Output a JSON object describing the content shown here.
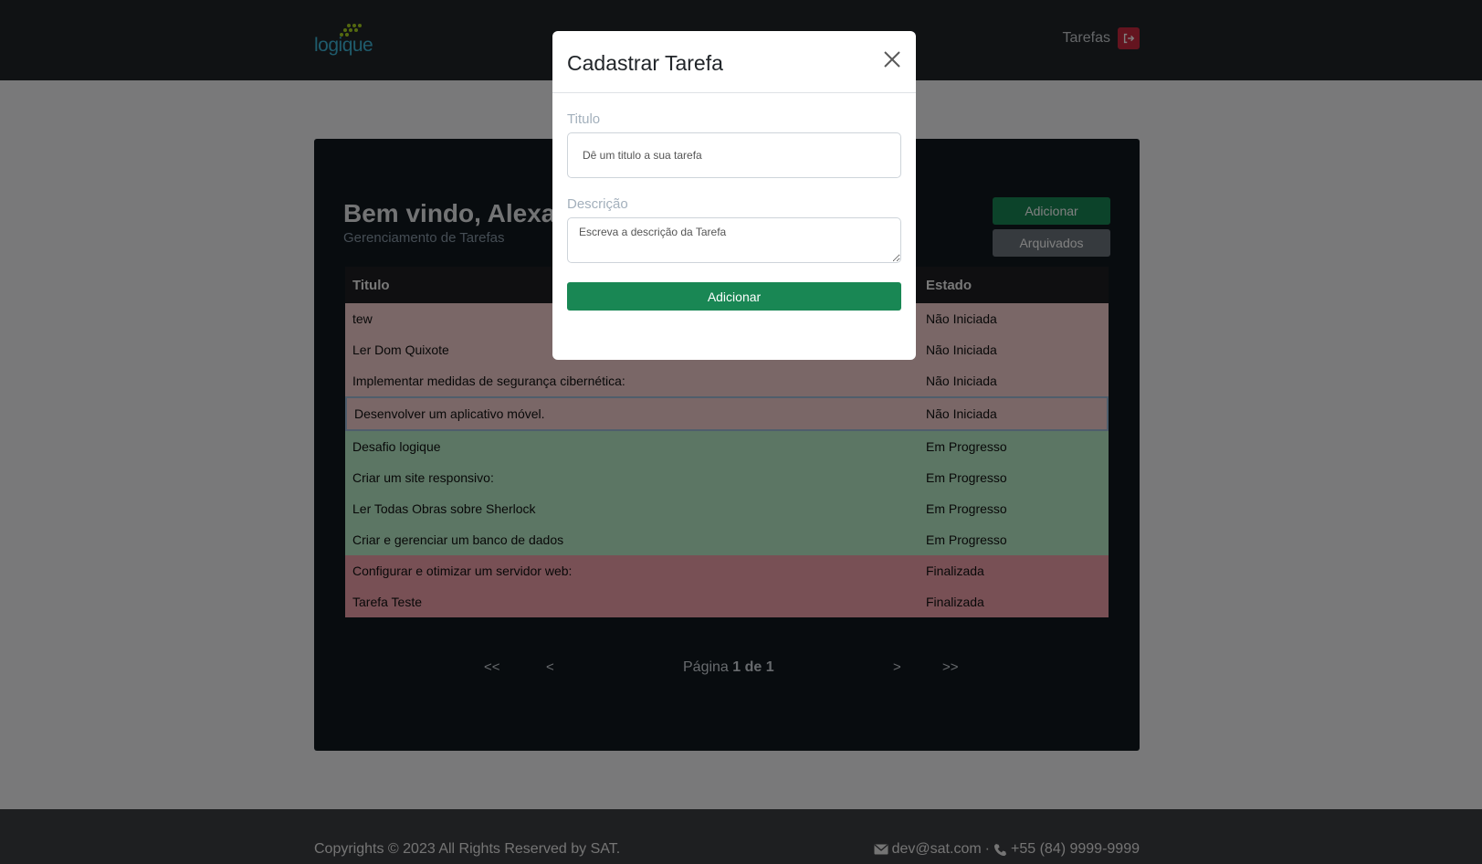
{
  "navbar": {
    "logo_text": "logique",
    "nav_link": "Tarefas"
  },
  "main": {
    "welcome": "Bem vindo, Alexa",
    "subtitle": "Gerenciamento de Tarefas",
    "add_button": "Adicionar",
    "archived_button": "Arquivados",
    "table": {
      "headers": [
        "Titulo",
        "Estado"
      ],
      "rows": [
        {
          "title": "tew",
          "state": "Não Iniciada"
        },
        {
          "title": "Ler Dom Quixote",
          "state": "Não Iniciada"
        },
        {
          "title": "Implementar medidas de segurança cibernética:",
          "state": "Não Iniciada"
        },
        {
          "title": "Desenvolver um aplicativo móvel.",
          "state": "Não Iniciada"
        },
        {
          "title": "Desafio logique",
          "state": "Em Progresso"
        },
        {
          "title": "Criar um site responsivo:",
          "state": "Em Progresso"
        },
        {
          "title": "Ler Todas Obras sobre Sherlock",
          "state": "Em Progresso"
        },
        {
          "title": "Criar e gerenciar um banco de dados",
          "state": "Em Progresso"
        },
        {
          "title": "Configurar e otimizar um servidor web:",
          "state": "Finalizada"
        },
        {
          "title": "Tarefa Teste",
          "state": "Finalizada"
        }
      ]
    },
    "pagination": {
      "first": "<<",
      "prev": "<",
      "label": "Página",
      "current": "1 de 1",
      "next": ">",
      "last": ">>"
    }
  },
  "footer": {
    "copyright": "Copyrights © 2023 All Rights Reserved by SAT.",
    "email": "dev@sat.com",
    "separator": "·",
    "phone": "+55 (84) 9999-9999"
  },
  "modal": {
    "title": "Cadastrar Tarefa",
    "title_label": "Titulo",
    "title_placeholder": "Dê um titulo a sua tarefa",
    "description_label": "Descrição",
    "description_placeholder": "Escreva a descrição da Tarefa",
    "submit_label": "Adicionar"
  },
  "colors": {
    "accent_green": "#198754",
    "secondary_gray": "#6c757d",
    "danger_red": "#c8293f",
    "row_not_started": "#f4cfcf",
    "row_in_progress": "#b8ecc9",
    "row_finished": "#f0a0ab"
  }
}
